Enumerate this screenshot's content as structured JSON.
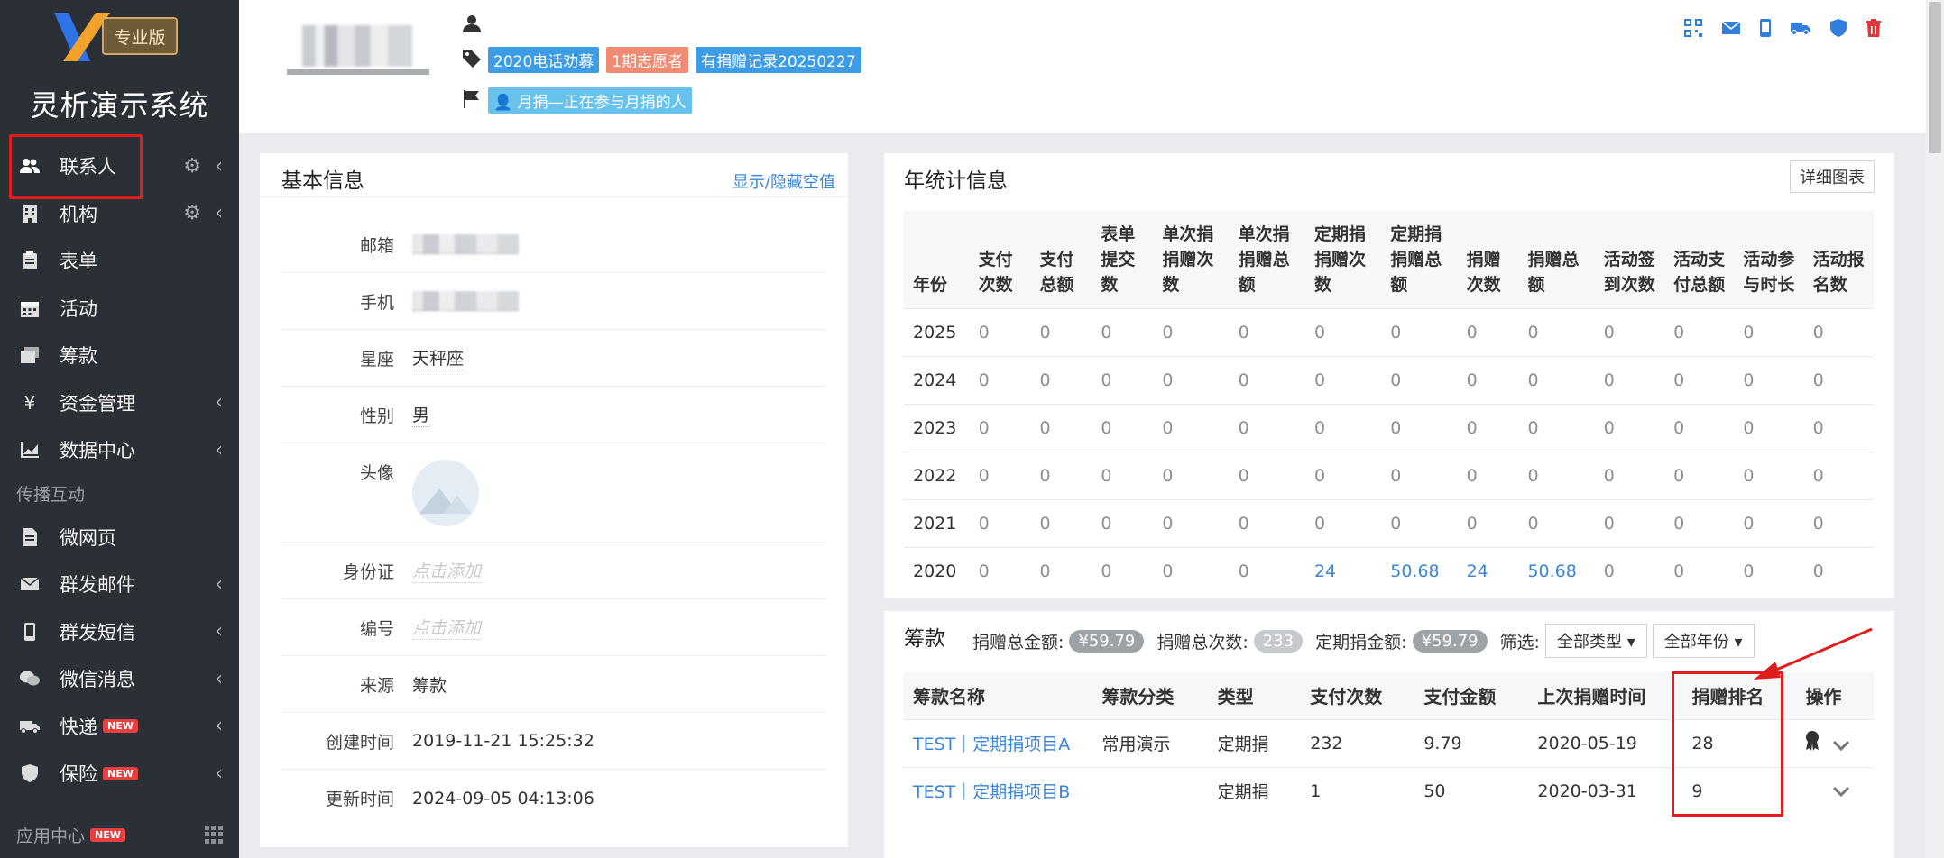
{
  "brand": {
    "badge": "专业版",
    "title": "灵析演示系统"
  },
  "sidebar": {
    "items": [
      {
        "label": "联系人",
        "icon": "contacts-icon",
        "gear": true,
        "chevron": true
      },
      {
        "label": "机构",
        "icon": "building-icon",
        "gear": true,
        "chevron": true
      },
      {
        "label": "表单",
        "icon": "clipboard-icon"
      },
      {
        "label": "活动",
        "icon": "calendar-icon"
      },
      {
        "label": "筹款",
        "icon": "wallet-icon"
      },
      {
        "label": "资金管理",
        "icon": "yen-icon",
        "chevron": true
      },
      {
        "label": "数据中心",
        "icon": "chart-icon",
        "chevron": true
      }
    ],
    "section": "传播互动",
    "items2": [
      {
        "label": "微网页",
        "icon": "document-icon"
      },
      {
        "label": "群发邮件",
        "icon": "mail-icon",
        "chevron": true
      },
      {
        "label": "群发短信",
        "icon": "phone-icon",
        "chevron": true
      },
      {
        "label": "微信消息",
        "icon": "wechat-icon",
        "chevron": true
      },
      {
        "label": "快递",
        "icon": "truck-icon",
        "badge": "NEW",
        "chevron": true
      },
      {
        "label": "保险",
        "icon": "shield-icon",
        "badge": "NEW",
        "chevron": true
      }
    ],
    "app_center": "应用中心",
    "app_center_badge": "NEW"
  },
  "header": {
    "tags": [
      "2020电话劝募",
      "1期志愿者",
      "有捐赠记录20250227"
    ],
    "monthly_tag": "月捐—正在参与月捐的人"
  },
  "basic_info": {
    "title": "基本信息",
    "toggle_link": "显示/隐藏空值",
    "rows": [
      {
        "label": "邮箱",
        "value": ""
      },
      {
        "label": "手机",
        "value": ""
      },
      {
        "label": "星座",
        "value": "天秤座"
      },
      {
        "label": "性别",
        "value": "男"
      },
      {
        "label": "头像",
        "value": ""
      },
      {
        "label": "身份证",
        "value": "点击添加"
      },
      {
        "label": "编号",
        "value": "点击添加"
      },
      {
        "label": "来源",
        "value": "筹款"
      },
      {
        "label": "创建时间",
        "value": "2019-11-21 15:25:32"
      },
      {
        "label": "更新时间",
        "value": "2024-09-05 04:13:06"
      }
    ]
  },
  "yearly": {
    "title": "年统计信息",
    "detail_button": "详细图表",
    "columns": [
      "年份",
      "支付次数",
      "支付总额",
      "表单提交数",
      "单次捐捐赠次数",
      "单次捐捐赠总额",
      "定期捐捐赠次数",
      "定期捐捐赠总额",
      "捐赠次数",
      "捐赠总额",
      "活动签到次数",
      "活动支付总额",
      "活动参与时长",
      "活动报名数"
    ],
    "rows": [
      [
        "2025",
        "0",
        "0",
        "0",
        "0",
        "0",
        "0",
        "0",
        "0",
        "0",
        "0",
        "0",
        "0",
        "0"
      ],
      [
        "2024",
        "0",
        "0",
        "0",
        "0",
        "0",
        "0",
        "0",
        "0",
        "0",
        "0",
        "0",
        "0",
        "0"
      ],
      [
        "2023",
        "0",
        "0",
        "0",
        "0",
        "0",
        "0",
        "0",
        "0",
        "0",
        "0",
        "0",
        "0",
        "0"
      ],
      [
        "2022",
        "0",
        "0",
        "0",
        "0",
        "0",
        "0",
        "0",
        "0",
        "0",
        "0",
        "0",
        "0",
        "0"
      ],
      [
        "2021",
        "0",
        "0",
        "0",
        "0",
        "0",
        "0",
        "0",
        "0",
        "0",
        "0",
        "0",
        "0",
        "0"
      ],
      [
        "2020",
        "0",
        "0",
        "0",
        "0",
        "0",
        "24",
        "50.68",
        "24",
        "50.68",
        "0",
        "0",
        "0",
        "0"
      ]
    ]
  },
  "funds": {
    "title": "筹款",
    "total_amount_label": "捐赠总金额:",
    "total_amount": "¥59.79",
    "total_count_label": "捐赠总次数:",
    "total_count": "233",
    "recurring_label": "定期捐金额:",
    "recurring_amount": "¥59.79",
    "filter_label": "筛选:",
    "type_filter": "全部类型",
    "year_filter": "全部年份",
    "columns": [
      "筹款名称",
      "筹款分类",
      "类型",
      "支付次数",
      "支付金额",
      "上次捐赠时间",
      "捐赠排名",
      "操作"
    ],
    "rows": [
      {
        "name": "TEST｜定期捐项目A",
        "category": "常用演示",
        "type": "定期捐",
        "pay_count": "232",
        "pay_amount": "9.79",
        "last_time": "2020-05-19",
        "rank": "28"
      },
      {
        "name": "TEST｜定期捐项目B",
        "category": "",
        "type": "定期捐",
        "pay_count": "1",
        "pay_amount": "50",
        "last_time": "2020-03-31",
        "rank": "9"
      }
    ]
  },
  "colors": {
    "accent": "#3a86d6",
    "sidebar_bg": "#2b2f36",
    "highlight_red": "#e11c1c"
  }
}
